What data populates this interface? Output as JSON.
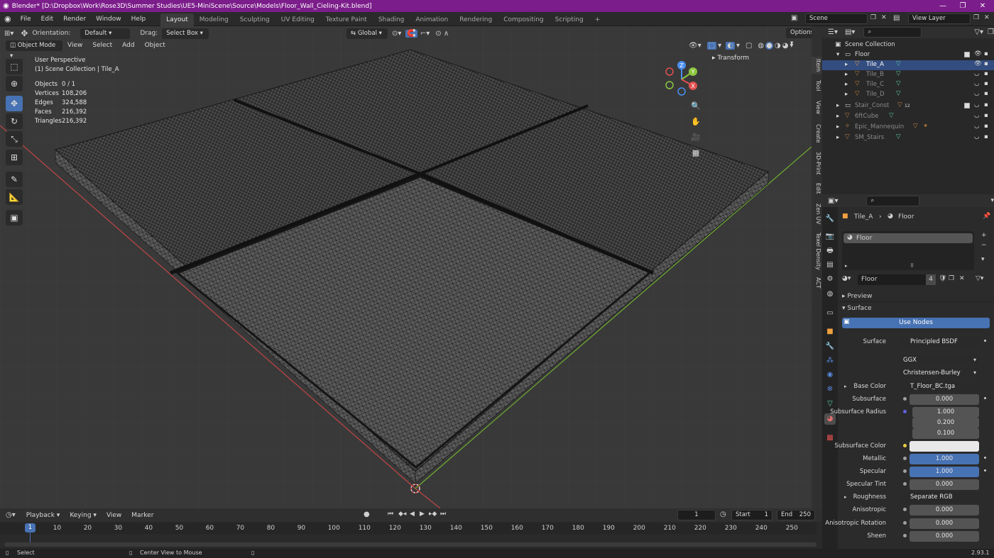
{
  "window": {
    "title": "Blender* [D:\\Dropbox\\Work\\Rose3D\\Summer Studies\\UE5-MiniScene\\Source\\Models\\Floor_Wall_Cieling-Kit.blend]"
  },
  "menu": [
    "File",
    "Edit",
    "Render",
    "Window",
    "Help"
  ],
  "workspaces": [
    "Layout",
    "Modeling",
    "Sculpting",
    "UV Editing",
    "Texture Paint",
    "Shading",
    "Animation",
    "Rendering",
    "Compositing",
    "Scripting"
  ],
  "scene": {
    "name": "Scene",
    "view_layer": "View Layer"
  },
  "viewport": {
    "orientation_label": "Orientation:",
    "orientation_value": "Default",
    "drag_label": "Drag:",
    "drag_value": "Select Box",
    "transform_orientation": "Global",
    "options": "Options",
    "mode": "Object Mode",
    "menus": [
      "View",
      "Select",
      "Add",
      "Object"
    ],
    "perspective": "User Perspective",
    "collection_info": "(1) Scene Collection | Tile_A",
    "stats": [
      {
        "label": "Objects",
        "value": "0 / 1"
      },
      {
        "label": "Vertices",
        "value": "108,206"
      },
      {
        "label": "Edges",
        "value": "324,588"
      },
      {
        "label": "Faces",
        "value": "216,392"
      },
      {
        "label": "Triangles",
        "value": "216,392"
      }
    ],
    "transform_panel": "Transform",
    "side_tabs": [
      "Item",
      "Tool",
      "View",
      "Create",
      "3D-Print",
      "Edit",
      "Zen UV",
      "Texel Density",
      "ACT"
    ],
    "gizmo_axes": [
      "Z",
      "Y",
      "X"
    ]
  },
  "outliner": {
    "root": "Scene Collection",
    "items": [
      {
        "name": "Floor"
      },
      {
        "name": "Tile_A"
      },
      {
        "name": "Tile_B"
      },
      {
        "name": "Tile_C"
      },
      {
        "name": "Tile_D"
      },
      {
        "name": "Stair_Const"
      },
      {
        "name": "6ftCube"
      },
      {
        "name": "Epic_Mannequin"
      },
      {
        "name": "SM_Stairs"
      }
    ],
    "stair_badge": "12"
  },
  "properties": {
    "breadcrumb_object": "Tile_A",
    "breadcrumb_material": "Floor",
    "slot_name": "Floor",
    "material_name": "Floor",
    "user_count": "4",
    "preview_label": "Preview",
    "surface_label": "Surface",
    "use_nodes": "Use Nodes",
    "rows": {
      "surface": {
        "label": "Surface",
        "value": "Principled BSDF"
      },
      "distribution": "GGX",
      "subsurface_method": "Christensen-Burley",
      "base_color": {
        "label": "Base Color",
        "value": "T_Floor_BC.tga"
      },
      "subsurface": {
        "label": "Subsurface",
        "value": "0.000"
      },
      "subsurface_radius": {
        "label": "Subsurface Radius",
        "values": [
          "1.000",
          "0.200",
          "0.100"
        ]
      },
      "subsurface_color": {
        "label": "Subsurface Color"
      },
      "metallic": {
        "label": "Metallic",
        "value": "1.000"
      },
      "specular": {
        "label": "Specular",
        "value": "1.000"
      },
      "specular_tint": {
        "label": "Specular Tint",
        "value": "0.000"
      },
      "roughness": {
        "label": "Roughness",
        "value": "Separate RGB"
      },
      "anisotropic": {
        "label": "Anisotropic",
        "value": "0.000"
      },
      "anisotropic_rotation": {
        "label": "Anisotropic Rotation",
        "value": "0.000"
      },
      "sheen": {
        "label": "Sheen",
        "value": "0.000"
      }
    }
  },
  "timeline": {
    "menus": [
      "Playback",
      "Keying",
      "View",
      "Marker"
    ],
    "current_frame": "1",
    "start_label": "Start",
    "start": "1",
    "end_label": "End",
    "end": "250",
    "ticks": [
      "1",
      "10",
      "20",
      "30",
      "40",
      "50",
      "60",
      "70",
      "80",
      "90",
      "100",
      "110",
      "120",
      "130",
      "140",
      "150",
      "160",
      "170",
      "180",
      "190",
      "200",
      "210",
      "220",
      "230",
      "240",
      "250"
    ]
  },
  "status": {
    "select": "Select",
    "center_view": "Center View to Mouse",
    "version": "2.93.1"
  },
  "colors": {
    "title_bar": "#7b1d8a",
    "accent_blue": "#4772b3",
    "viewport_bg": "#393939",
    "axis_x": "#e05050",
    "axis_y": "#8cc63f",
    "axis_z": "#4a8ef0"
  }
}
